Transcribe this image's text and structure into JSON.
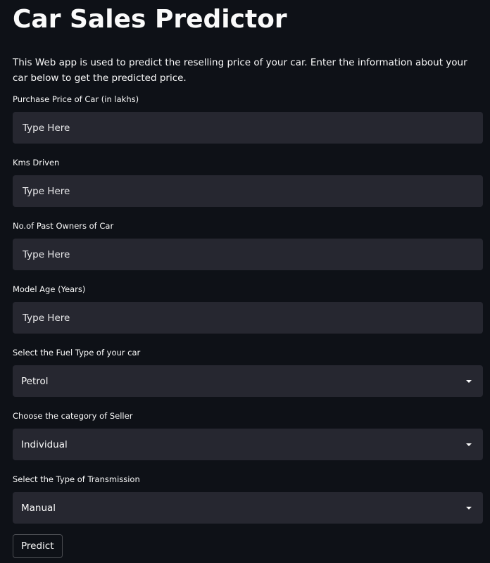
{
  "title": "Car Sales Predictor",
  "description": "This Web app is used to predict the reselling price of your car. Enter the information about your car below to get the predicted price.",
  "fields": [
    {
      "label": "Purchase Price of Car (in lakhs)",
      "placeholder": "Type Here",
      "value": ""
    },
    {
      "label": "Kms Driven",
      "placeholder": "Type Here",
      "value": ""
    },
    {
      "label": "No.of Past Owners of Car",
      "placeholder": "Type Here",
      "value": ""
    },
    {
      "label": "Model Age (Years)",
      "placeholder": "Type Here",
      "value": ""
    }
  ],
  "selects": [
    {
      "label": "Select the Fuel Type of your car",
      "value": "Petrol"
    },
    {
      "label": "Choose the category of Seller",
      "value": "Individual"
    },
    {
      "label": "Select the Type of Transmission",
      "value": "Manual"
    }
  ],
  "predict_button": "Predict",
  "icons": {
    "dropdown": "chevron-down-icon"
  },
  "colors": {
    "background": "#0e1117",
    "input_background": "#262730",
    "text": "#fafafa"
  }
}
